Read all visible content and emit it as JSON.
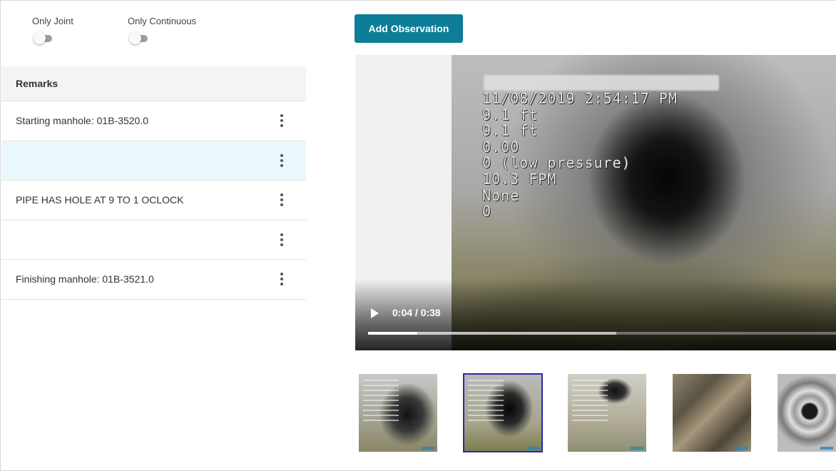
{
  "filters": {
    "only_joint_label": "Only Joint",
    "only_joint_on": false,
    "only_continuous_label": "Only Continuous",
    "only_continuous_on": false
  },
  "remarks": {
    "header": "Remarks",
    "rows": [
      {
        "text": "Starting manhole: 01B-3520.0",
        "selected": false
      },
      {
        "text": "",
        "selected": true
      },
      {
        "text": "PIPE HAS HOLE AT 9 TO 1 OCLOCK",
        "selected": false
      },
      {
        "text": "",
        "selected": false
      },
      {
        "text": "Finishing manhole: 01B-3521.0",
        "selected": false
      }
    ]
  },
  "toolbar": {
    "add_observation_label": "Add Observation"
  },
  "video": {
    "overlay_lines": [
      "11/08/2019 2:54:17 PM",
      "9.1 ft",
      "9.1 ft",
      "0.00",
      "0 (low pressure)",
      "10.3 FPM",
      "None",
      "0"
    ],
    "time_display": "0:04 / 0:38",
    "current_seconds": 4,
    "duration_seconds": 38,
    "buffered_fraction": 0.53
  },
  "thumbnails": {
    "count": 5,
    "selected_index": 1
  },
  "colors": {
    "primary_button": "#0e7d98",
    "selected_row": "#ebf8fb",
    "selected_thumb_border": "#2a2aa8"
  }
}
